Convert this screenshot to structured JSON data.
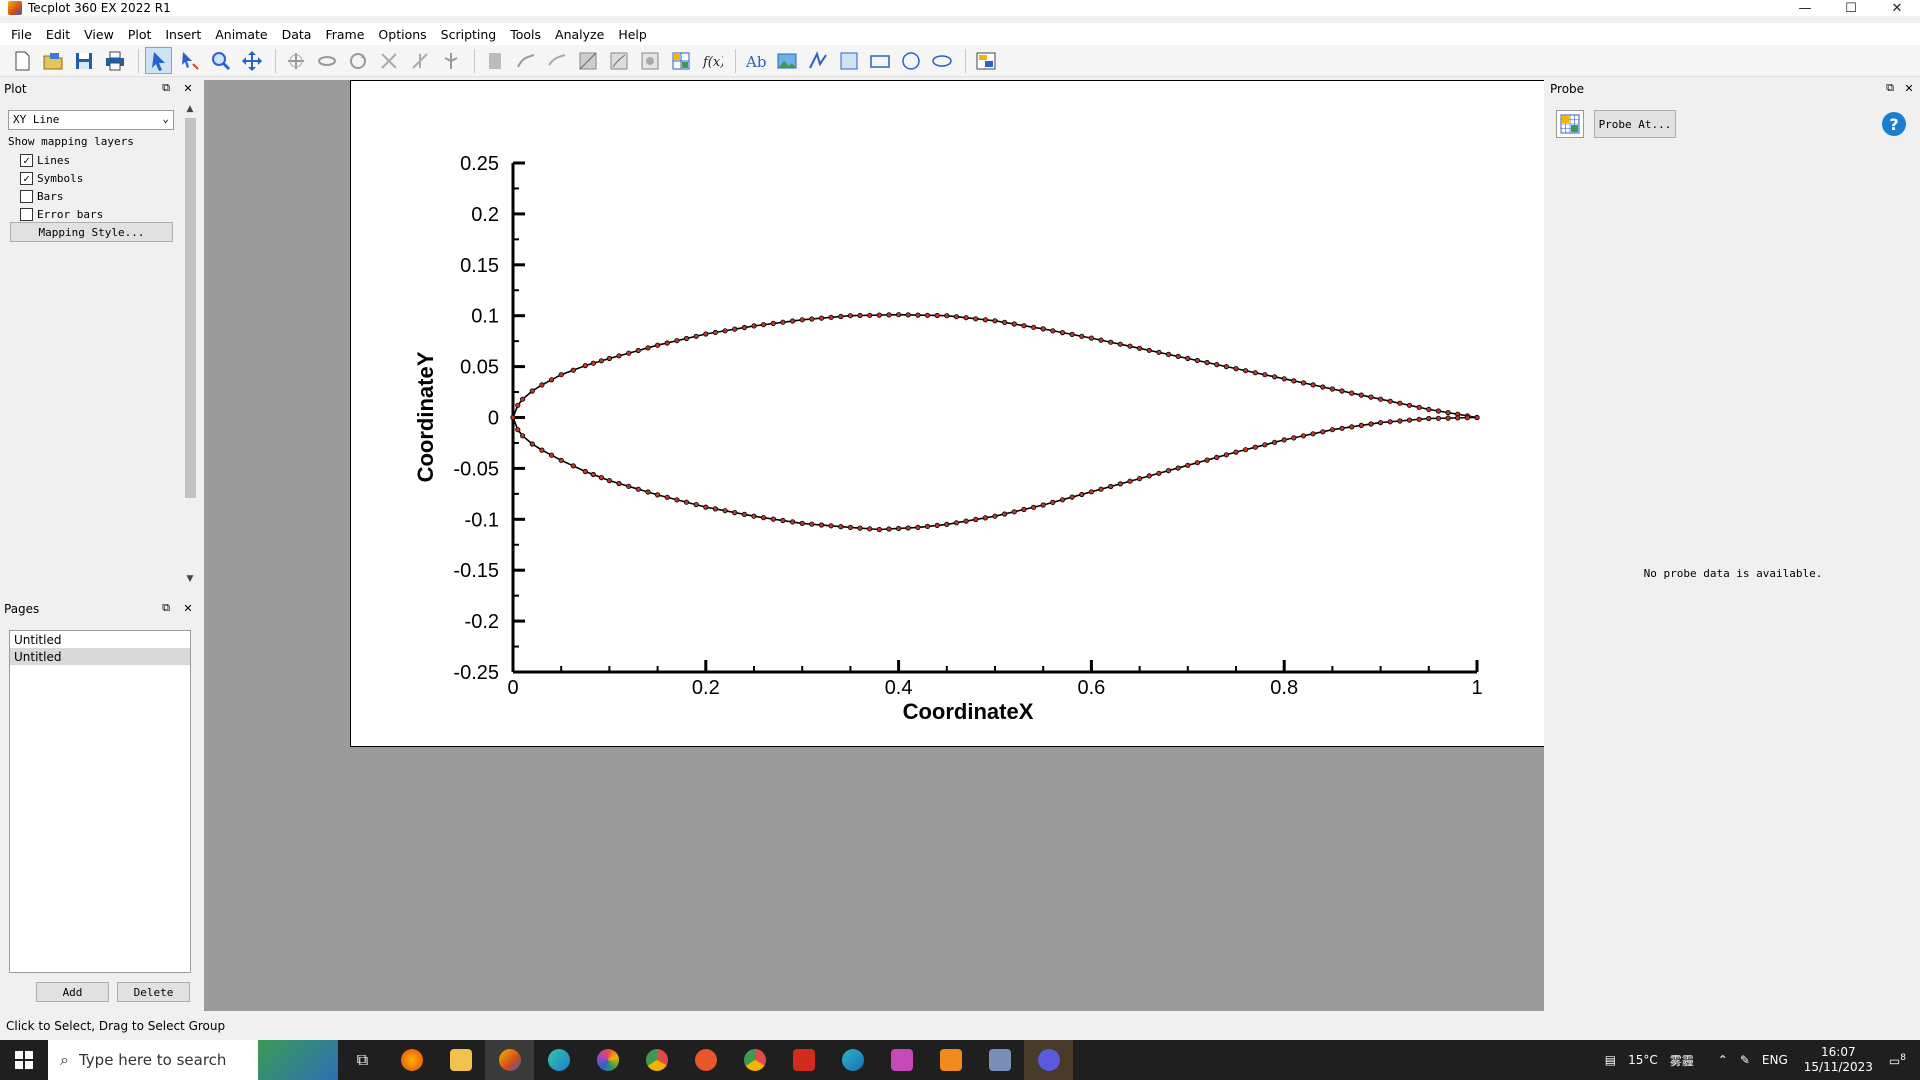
{
  "window": {
    "title": "Tecplot 360 EX 2022 R1",
    "minimize": "—",
    "maximize": "☐",
    "close": "✕"
  },
  "menu": [
    "File",
    "Edit",
    "View",
    "Plot",
    "Insert",
    "Animate",
    "Data",
    "Frame",
    "Options",
    "Scripting",
    "Tools",
    "Analyze",
    "Help"
  ],
  "plot_panel": {
    "header": "Plot",
    "plot_type": "XY Line",
    "show_mapping_label": "Show mapping layers",
    "layers": [
      {
        "label": "Lines",
        "checked": true
      },
      {
        "label": "Symbols",
        "checked": true
      },
      {
        "label": "Bars",
        "checked": false
      },
      {
        "label": "Error bars",
        "checked": false
      }
    ],
    "mapping_style_button": "Mapping Style..."
  },
  "pages_panel": {
    "header": "Pages",
    "pages": [
      "Untitled",
      "Untitled"
    ],
    "selected_index": 1,
    "add_button": "Add",
    "delete_button": "Delete"
  },
  "probe_panel": {
    "header": "Probe",
    "probe_button": "Probe At...",
    "empty_message": "No probe data is available.",
    "help": "?"
  },
  "status": "Click to Select, Drag to Select Group",
  "taskbar": {
    "search_placeholder": "Type here to search",
    "weather": "15°C",
    "weather_extra": "雾霾",
    "language": "ENG",
    "time": "16:07",
    "date": "15/11/2023",
    "notifications": "8"
  },
  "chart_data": {
    "type": "line",
    "xlabel": "CoordinateX",
    "ylabel": "CoordinateY",
    "xlim": [
      0,
      1
    ],
    "ylim": [
      -0.25,
      0.25
    ],
    "xticks": [
      0,
      0.2,
      0.4,
      0.6,
      0.8,
      1
    ],
    "xtick_labels": [
      "0",
      "0.2",
      "0.4",
      "0.6",
      "0.8",
      "1"
    ],
    "yticks": [
      0.25,
      0.2,
      0.15,
      0.1,
      0.05,
      0,
      -0.05,
      -0.1,
      -0.15,
      -0.2,
      -0.25
    ],
    "ytick_labels": [
      "0.25",
      "0.2",
      "0.15",
      "0.1",
      "0.05",
      "0",
      "-0.05",
      "-0.1",
      "-0.15",
      "-0.2",
      "-0.25"
    ],
    "grid": false,
    "legend": "none",
    "line_color": "#000000",
    "symbol_color": "#c0392b",
    "series": [
      {
        "values_upper": [
          [
            0,
            0
          ],
          [
            0.005,
            0.012
          ],
          [
            0.01,
            0.018
          ],
          [
            0.02,
            0.026
          ],
          [
            0.03,
            0.032
          ],
          [
            0.05,
            0.042
          ],
          [
            0.075,
            0.051
          ],
          [
            0.1,
            0.058
          ],
          [
            0.15,
            0.071
          ],
          [
            0.2,
            0.082
          ],
          [
            0.25,
            0.09
          ],
          [
            0.3,
            0.096
          ],
          [
            0.35,
            0.1
          ],
          [
            0.4,
            0.101
          ],
          [
            0.45,
            0.1
          ],
          [
            0.5,
            0.095
          ],
          [
            0.55,
            0.087
          ],
          [
            0.6,
            0.078
          ],
          [
            0.65,
            0.068
          ],
          [
            0.7,
            0.058
          ],
          [
            0.75,
            0.048
          ],
          [
            0.8,
            0.038
          ],
          [
            0.85,
            0.028
          ],
          [
            0.9,
            0.018
          ],
          [
            0.95,
            0.008
          ],
          [
            1,
            0
          ]
        ],
        "values_lower": [
          [
            0,
            0
          ],
          [
            0.005,
            -0.012
          ],
          [
            0.01,
            -0.018
          ],
          [
            0.02,
            -0.026
          ],
          [
            0.03,
            -0.032
          ],
          [
            0.05,
            -0.042
          ],
          [
            0.075,
            -0.053
          ],
          [
            0.1,
            -0.062
          ],
          [
            0.15,
            -0.076
          ],
          [
            0.2,
            -0.088
          ],
          [
            0.25,
            -0.097
          ],
          [
            0.3,
            -0.104
          ],
          [
            0.35,
            -0.108
          ],
          [
            0.38,
            -0.11
          ],
          [
            0.42,
            -0.108
          ],
          [
            0.45,
            -0.105
          ],
          [
            0.5,
            -0.097
          ],
          [
            0.55,
            -0.086
          ],
          [
            0.6,
            -0.073
          ],
          [
            0.65,
            -0.06
          ],
          [
            0.7,
            -0.047
          ],
          [
            0.75,
            -0.034
          ],
          [
            0.8,
            -0.022
          ],
          [
            0.85,
            -0.012
          ],
          [
            0.9,
            -0.005
          ],
          [
            0.95,
            -0.001
          ],
          [
            1,
            0
          ]
        ]
      }
    ]
  }
}
